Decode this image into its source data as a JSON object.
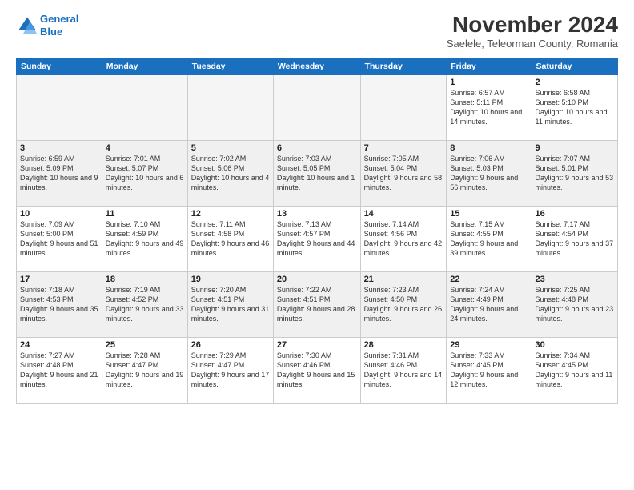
{
  "logo": {
    "line1": "General",
    "line2": "Blue"
  },
  "title": "November 2024",
  "subtitle": "Saelele, Teleorman County, Romania",
  "weekdays": [
    "Sunday",
    "Monday",
    "Tuesday",
    "Wednesday",
    "Thursday",
    "Friday",
    "Saturday"
  ],
  "weeks": [
    [
      {
        "num": "",
        "info": ""
      },
      {
        "num": "",
        "info": ""
      },
      {
        "num": "",
        "info": ""
      },
      {
        "num": "",
        "info": ""
      },
      {
        "num": "",
        "info": ""
      },
      {
        "num": "1",
        "info": "Sunrise: 6:57 AM\nSunset: 5:11 PM\nDaylight: 10 hours and 14 minutes."
      },
      {
        "num": "2",
        "info": "Sunrise: 6:58 AM\nSunset: 5:10 PM\nDaylight: 10 hours and 11 minutes."
      }
    ],
    [
      {
        "num": "3",
        "info": "Sunrise: 6:59 AM\nSunset: 5:09 PM\nDaylight: 10 hours and 9 minutes."
      },
      {
        "num": "4",
        "info": "Sunrise: 7:01 AM\nSunset: 5:07 PM\nDaylight: 10 hours and 6 minutes."
      },
      {
        "num": "5",
        "info": "Sunrise: 7:02 AM\nSunset: 5:06 PM\nDaylight: 10 hours and 4 minutes."
      },
      {
        "num": "6",
        "info": "Sunrise: 7:03 AM\nSunset: 5:05 PM\nDaylight: 10 hours and 1 minute."
      },
      {
        "num": "7",
        "info": "Sunrise: 7:05 AM\nSunset: 5:04 PM\nDaylight: 9 hours and 58 minutes."
      },
      {
        "num": "8",
        "info": "Sunrise: 7:06 AM\nSunset: 5:03 PM\nDaylight: 9 hours and 56 minutes."
      },
      {
        "num": "9",
        "info": "Sunrise: 7:07 AM\nSunset: 5:01 PM\nDaylight: 9 hours and 53 minutes."
      }
    ],
    [
      {
        "num": "10",
        "info": "Sunrise: 7:09 AM\nSunset: 5:00 PM\nDaylight: 9 hours and 51 minutes."
      },
      {
        "num": "11",
        "info": "Sunrise: 7:10 AM\nSunset: 4:59 PM\nDaylight: 9 hours and 49 minutes."
      },
      {
        "num": "12",
        "info": "Sunrise: 7:11 AM\nSunset: 4:58 PM\nDaylight: 9 hours and 46 minutes."
      },
      {
        "num": "13",
        "info": "Sunrise: 7:13 AM\nSunset: 4:57 PM\nDaylight: 9 hours and 44 minutes."
      },
      {
        "num": "14",
        "info": "Sunrise: 7:14 AM\nSunset: 4:56 PM\nDaylight: 9 hours and 42 minutes."
      },
      {
        "num": "15",
        "info": "Sunrise: 7:15 AM\nSunset: 4:55 PM\nDaylight: 9 hours and 39 minutes."
      },
      {
        "num": "16",
        "info": "Sunrise: 7:17 AM\nSunset: 4:54 PM\nDaylight: 9 hours and 37 minutes."
      }
    ],
    [
      {
        "num": "17",
        "info": "Sunrise: 7:18 AM\nSunset: 4:53 PM\nDaylight: 9 hours and 35 minutes."
      },
      {
        "num": "18",
        "info": "Sunrise: 7:19 AM\nSunset: 4:52 PM\nDaylight: 9 hours and 33 minutes."
      },
      {
        "num": "19",
        "info": "Sunrise: 7:20 AM\nSunset: 4:51 PM\nDaylight: 9 hours and 31 minutes."
      },
      {
        "num": "20",
        "info": "Sunrise: 7:22 AM\nSunset: 4:51 PM\nDaylight: 9 hours and 28 minutes."
      },
      {
        "num": "21",
        "info": "Sunrise: 7:23 AM\nSunset: 4:50 PM\nDaylight: 9 hours and 26 minutes."
      },
      {
        "num": "22",
        "info": "Sunrise: 7:24 AM\nSunset: 4:49 PM\nDaylight: 9 hours and 24 minutes."
      },
      {
        "num": "23",
        "info": "Sunrise: 7:25 AM\nSunset: 4:48 PM\nDaylight: 9 hours and 23 minutes."
      }
    ],
    [
      {
        "num": "24",
        "info": "Sunrise: 7:27 AM\nSunset: 4:48 PM\nDaylight: 9 hours and 21 minutes."
      },
      {
        "num": "25",
        "info": "Sunrise: 7:28 AM\nSunset: 4:47 PM\nDaylight: 9 hours and 19 minutes."
      },
      {
        "num": "26",
        "info": "Sunrise: 7:29 AM\nSunset: 4:47 PM\nDaylight: 9 hours and 17 minutes."
      },
      {
        "num": "27",
        "info": "Sunrise: 7:30 AM\nSunset: 4:46 PM\nDaylight: 9 hours and 15 minutes."
      },
      {
        "num": "28",
        "info": "Sunrise: 7:31 AM\nSunset: 4:46 PM\nDaylight: 9 hours and 14 minutes."
      },
      {
        "num": "29",
        "info": "Sunrise: 7:33 AM\nSunset: 4:45 PM\nDaylight: 9 hours and 12 minutes."
      },
      {
        "num": "30",
        "info": "Sunrise: 7:34 AM\nSunset: 4:45 PM\nDaylight: 9 hours and 11 minutes."
      }
    ]
  ]
}
